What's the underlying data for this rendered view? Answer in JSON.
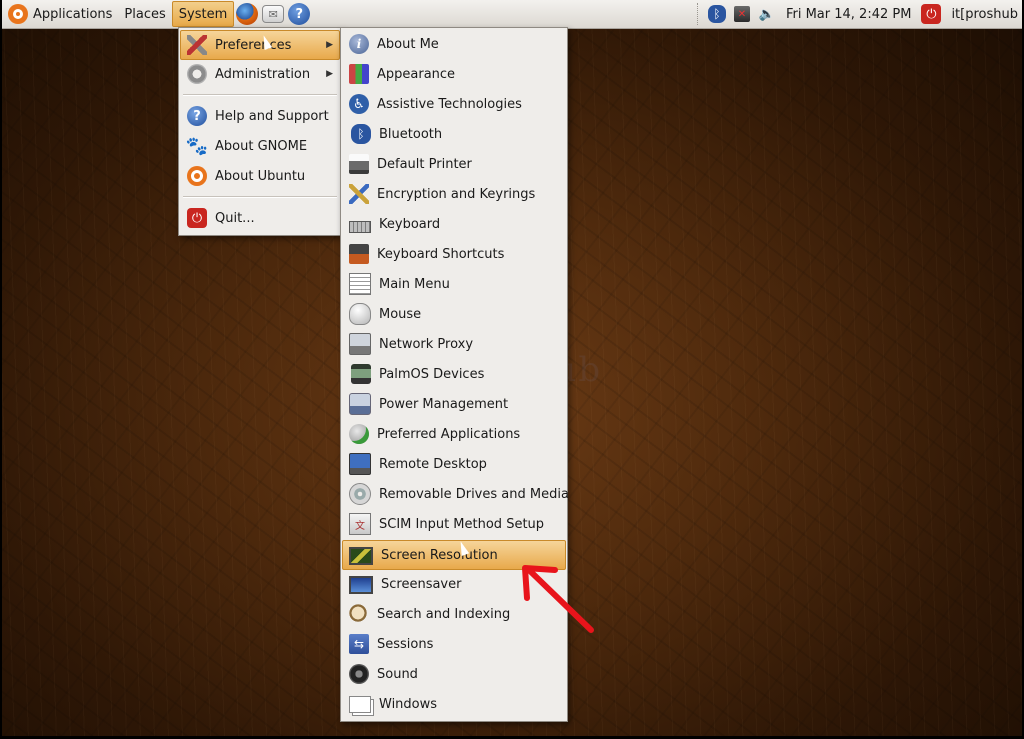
{
  "panel": {
    "applications": "Applications",
    "places": "Places",
    "system": "System",
    "clock": "Fri Mar 14,  2:42 PM",
    "user": "it[proshub"
  },
  "system_menu": {
    "items": [
      {
        "label": "Preferences",
        "icon": "tools-icon",
        "submenu": true
      },
      {
        "label": "Administration",
        "icon": "gear-icon",
        "submenu": true
      },
      {
        "label": "Help and Support",
        "icon": "help-icon"
      },
      {
        "label": "About GNOME",
        "icon": "gnome-foot-icon"
      },
      {
        "label": "About Ubuntu",
        "icon": "ubuntu-icon"
      },
      {
        "label": "Quit...",
        "icon": "quit-icon"
      }
    ]
  },
  "preferences_menu": {
    "items": [
      {
        "label": "About Me",
        "icon": "about-me-icon"
      },
      {
        "label": "Appearance",
        "icon": "appearance-icon"
      },
      {
        "label": "Assistive Technologies",
        "icon": "accessibility-icon"
      },
      {
        "label": "Bluetooth",
        "icon": "bluetooth-icon"
      },
      {
        "label": "Default Printer",
        "icon": "printer-icon"
      },
      {
        "label": "Encryption and Keyrings",
        "icon": "keyrings-icon"
      },
      {
        "label": "Keyboard",
        "icon": "keyboard-icon"
      },
      {
        "label": "Keyboard Shortcuts",
        "icon": "keyboard-shortcuts-icon"
      },
      {
        "label": "Main Menu",
        "icon": "main-menu-icon"
      },
      {
        "label": "Mouse",
        "icon": "mouse-icon"
      },
      {
        "label": "Network Proxy",
        "icon": "network-proxy-icon"
      },
      {
        "label": "PalmOS Devices",
        "icon": "palm-device-icon"
      },
      {
        "label": "Power Management",
        "icon": "power-management-icon"
      },
      {
        "label": "Preferred Applications",
        "icon": "preferred-applications-icon"
      },
      {
        "label": "Remote Desktop",
        "icon": "remote-desktop-icon"
      },
      {
        "label": "Removable Drives and Media",
        "icon": "removable-drive-icon"
      },
      {
        "label": "SCIM Input Method Setup",
        "icon": "scim-icon"
      },
      {
        "label": "Screen Resolution",
        "icon": "screen-resolution-icon",
        "highlighted": true
      },
      {
        "label": "Screensaver",
        "icon": "screensaver-icon"
      },
      {
        "label": "Search and Indexing",
        "icon": "search-indexing-icon"
      },
      {
        "label": "Sessions",
        "icon": "sessions-icon"
      },
      {
        "label": "Sound",
        "icon": "sound-icon"
      },
      {
        "label": "Windows",
        "icon": "windows-icon"
      }
    ]
  },
  "colors": {
    "highlight": "#e8a94b",
    "annotation_arrow": "#e8141b",
    "menu_bg": "#efedea"
  }
}
